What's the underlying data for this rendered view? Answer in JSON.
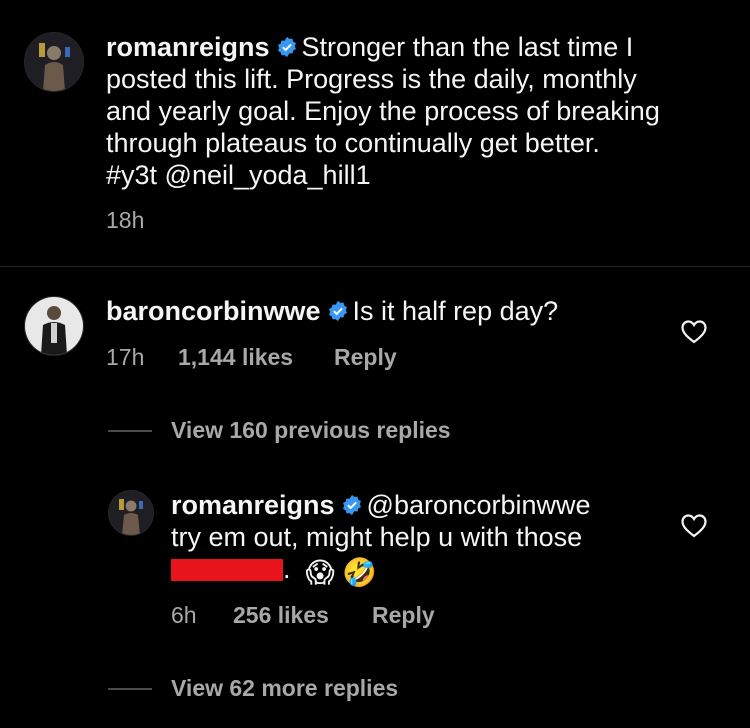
{
  "post": {
    "username": "romanreigns",
    "caption_line1": "Stronger than the last time I",
    "caption_line2": "posted this lift.  Progress is the daily, monthly",
    "caption_line3": "and yearly goal.  Enjoy the process of breaking",
    "caption_line4": "through plateaus to continually get better.",
    "caption_line5": "#y3t @neil_yoda_hill1",
    "time": "18h"
  },
  "comment1": {
    "username": "baroncorbinwwe",
    "text": "Is it half rep day?",
    "time": "17h",
    "likes": "1,144 likes",
    "reply": "Reply",
    "view_replies": "View 160 previous replies"
  },
  "reply1": {
    "username": "romanreigns",
    "mention": "@baroncorbinwwe",
    "text_line2": "try em out, might help u with those",
    "after_redaction": ".",
    "emoji1": "😱",
    "emoji2": "🤣",
    "time": "6h",
    "likes": "256 likes",
    "reply": "Reply",
    "view_more": "View 62 more replies"
  },
  "colors": {
    "background": "#000000",
    "text_primary": "#f5f5f5",
    "text_secondary": "#a8a8a8",
    "verified_blue": "#3897f0",
    "redaction": "#e8141b"
  },
  "icons": {
    "verified": "verified-badge-icon",
    "like": "heart-outline-icon"
  }
}
